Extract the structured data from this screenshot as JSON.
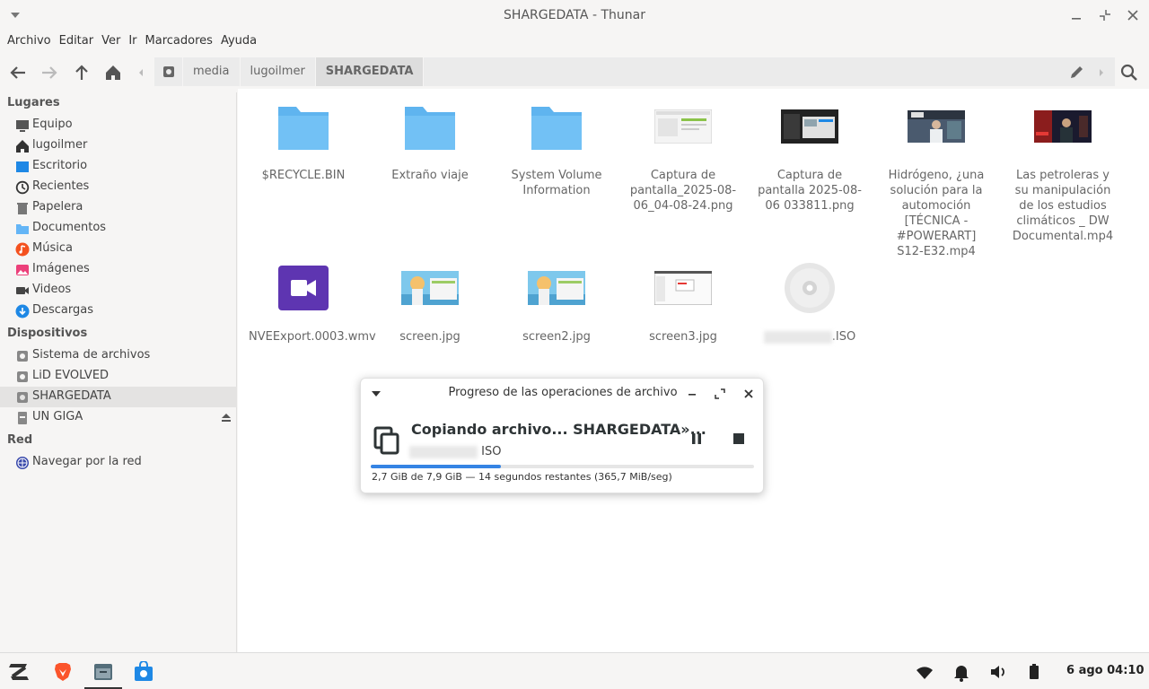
{
  "window": {
    "title": "SHARGEDATA - Thunar"
  },
  "menu": [
    "Archivo",
    "Editar",
    "Ver",
    "Ir",
    "Marcadores",
    "Ayuda"
  ],
  "breadcrumb": [
    "media",
    "lugoilmer",
    "SHARGEDATA"
  ],
  "sidebar": {
    "places_heading": "Lugares",
    "places": [
      "Equipo",
      "lugoilmer",
      "Escritorio",
      "Recientes",
      "Papelera",
      "Documentos",
      "Música",
      "Imágenes",
      "Videos",
      "Descargas"
    ],
    "devices_heading": "Dispositivos",
    "devices": [
      "Sistema de archivos",
      "LiD EVOLVED",
      "SHARGEDATA",
      "UN GIGA"
    ],
    "network_heading": "Red",
    "network": [
      "Navegar por la red"
    ]
  },
  "files": [
    {
      "name": "$RECYCLE.BIN",
      "icon": "folder-icon"
    },
    {
      "name": "Extraño viaje",
      "icon": "folder-icon"
    },
    {
      "name": "System Volume Information",
      "icon": "folder-icon"
    },
    {
      "name": "Captura de pantalla_2025-08-06_04-08-24.png",
      "icon": "image-thumbnail-icon"
    },
    {
      "name": "Captura de pantalla 2025-08-06 033811.png",
      "icon": "image-thumbnail-icon"
    },
    {
      "name": "Hidrógeno, ¿una solución para la automoción [TÉCNICA - #POWERART] S12-E32.mp4",
      "icon": "video-thumbnail-icon"
    },
    {
      "name": "Las petroleras y su manipulación de los estudios climáticos _ DW Documental.mp4",
      "icon": "video-thumbnail-icon"
    },
    {
      "name": "NVEExport.0003.wmv",
      "icon": "video-file-icon"
    },
    {
      "name": "screen.jpg",
      "icon": "image-thumbnail-icon"
    },
    {
      "name": "screen2.jpg",
      "icon": "image-thumbnail-icon"
    },
    {
      "name": "screen3.jpg",
      "icon": "image-thumbnail-icon"
    },
    {
      "name": ".ISO",
      "icon": "disc-image-icon"
    }
  ],
  "progress": {
    "title": "Progreso de las operaciones de archivo",
    "operation": "Copiando archivo... SHARGEDATA»...",
    "file_suffix": "ISO",
    "status": "2,7 GiB de 7,9 GiB — 14 segundos restantes (365,7 MiB/seg)",
    "fraction": 0.34
  },
  "taskbar": {
    "clock": "6 ago 04:10"
  },
  "colors": {
    "accent": "#3584e4",
    "folder": "#64b5f6",
    "video_app": "#5e35b1"
  }
}
